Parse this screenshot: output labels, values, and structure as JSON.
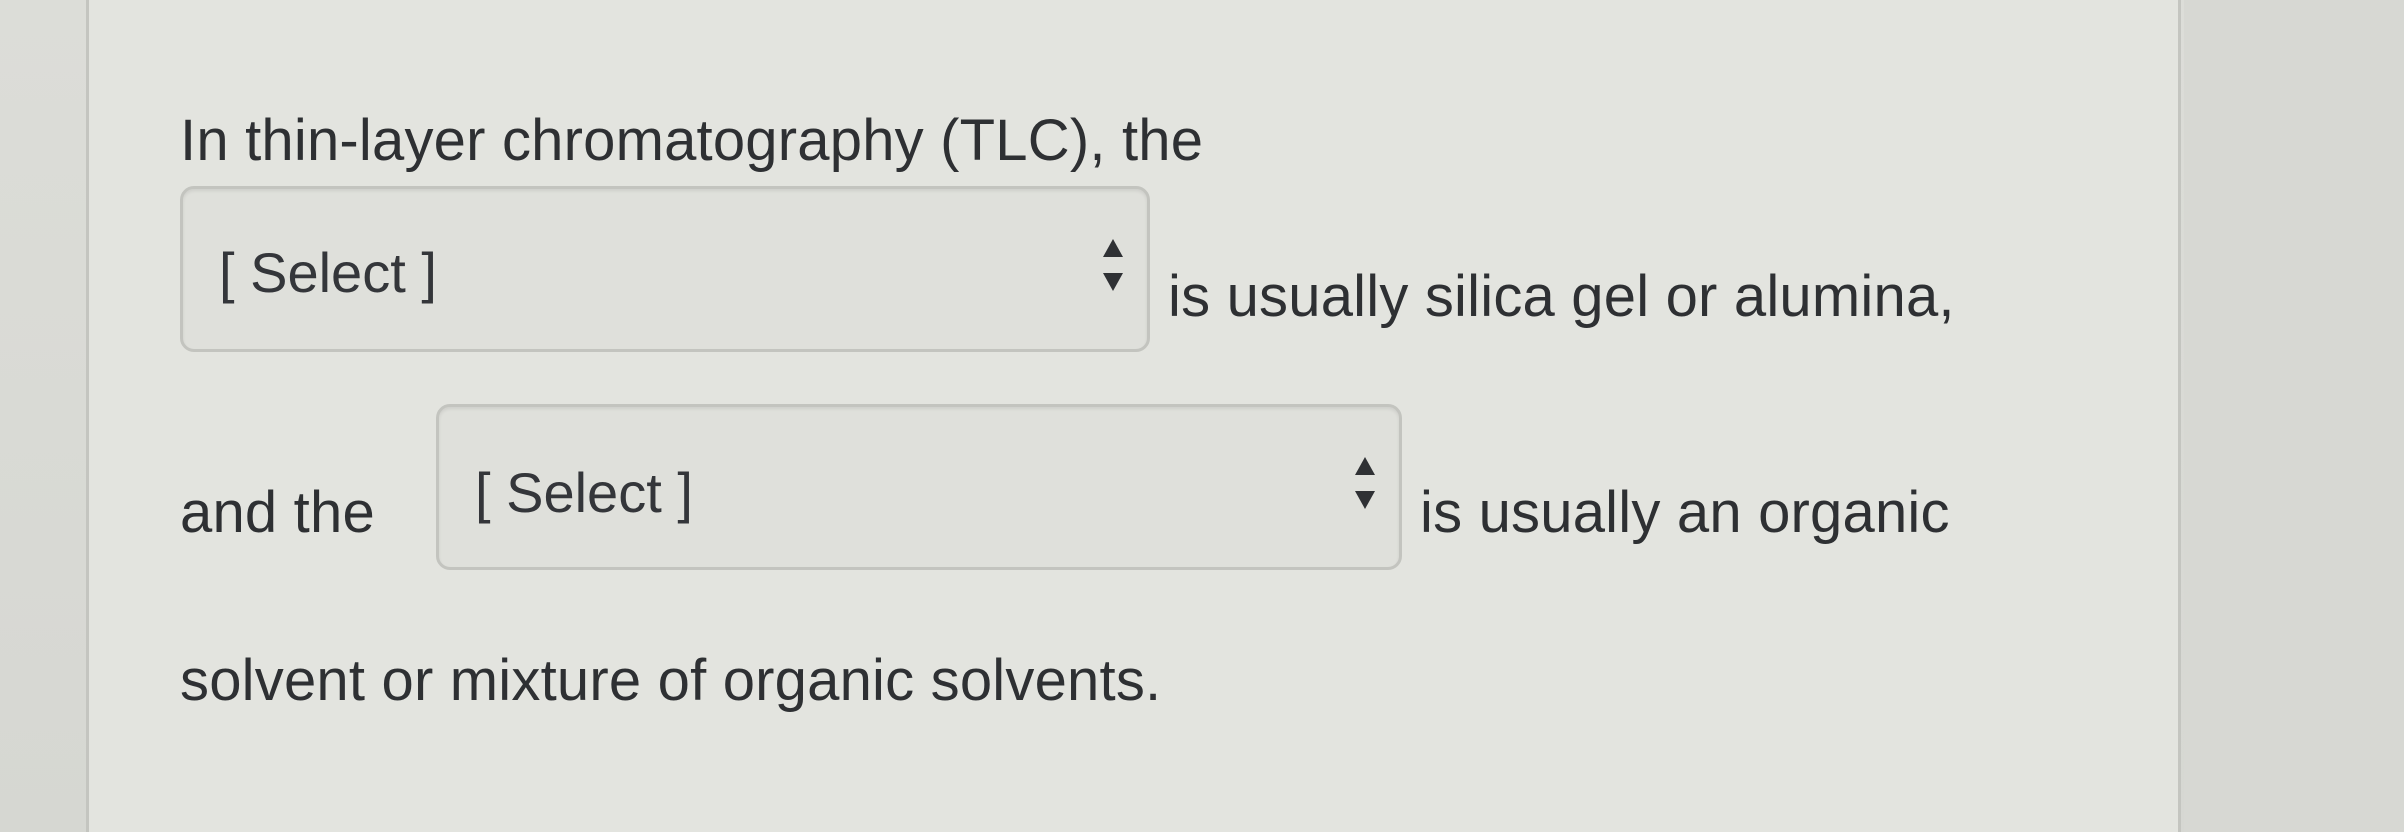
{
  "question": {
    "line1": "In thin-layer chromatography (TLC), the",
    "line2_after": "is usually silica gel or alumina,",
    "line3_before": "and the",
    "line3_after": "is usually an organic",
    "line4": "solvent or mixture of organic solvents."
  },
  "dropdowns": [
    {
      "selected": "[ Select ]"
    },
    {
      "selected": "[ Select ]"
    }
  ],
  "icons": {
    "dropdown_arrows": "updown-chevron-icon"
  }
}
